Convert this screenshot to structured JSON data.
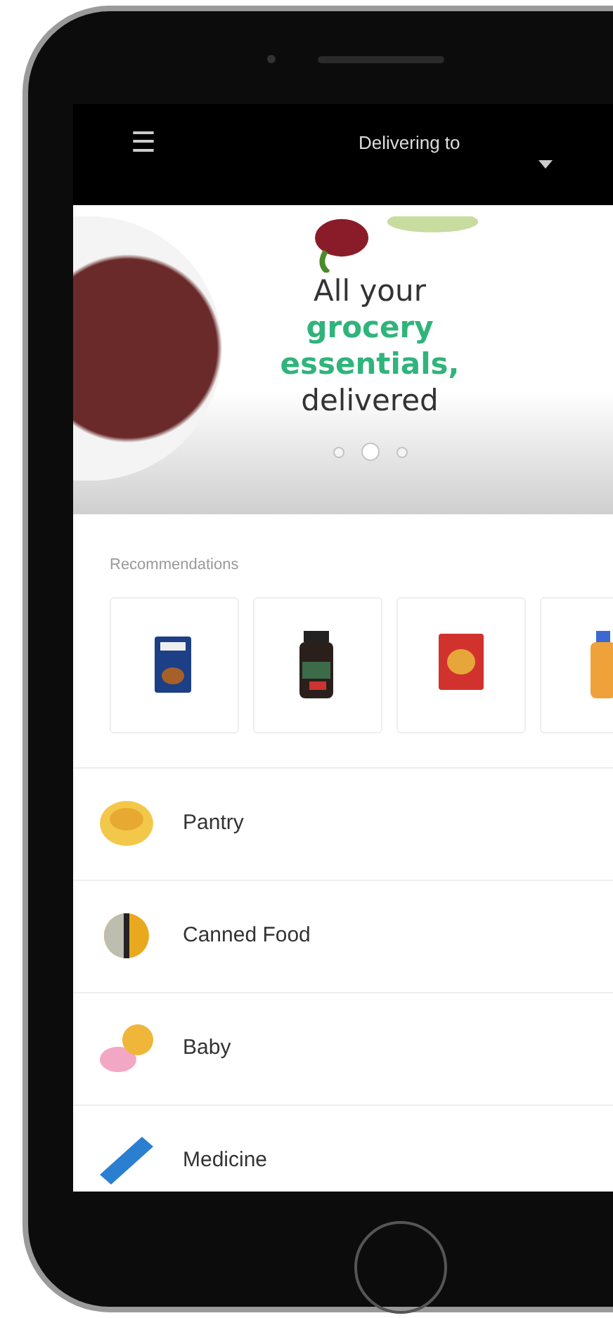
{
  "header": {
    "menu_icon": "☰",
    "title": "Delivering to"
  },
  "banner": {
    "lines": [
      {
        "text": "All your",
        "highlight": false
      },
      {
        "text": "grocery",
        "highlight": true
      },
      {
        "text": "essentials,",
        "highlight": true
      },
      {
        "text": "delivered",
        "highlight": false
      }
    ],
    "dots": [
      {
        "selected": false
      },
      {
        "selected": true
      },
      {
        "selected": false
      }
    ]
  },
  "recommendations": {
    "title": "Recommendations",
    "products": [
      {
        "kind": "box"
      },
      {
        "kind": "jar"
      },
      {
        "kind": "bag"
      },
      {
        "kind": "bottle"
      }
    ]
  },
  "categories": [
    {
      "kind": "pantry",
      "label": "Pantry"
    },
    {
      "kind": "canned",
      "label": "Canned Food"
    },
    {
      "kind": "baby",
      "label": "Baby"
    },
    {
      "kind": "medicine",
      "label": "Medicine"
    }
  ]
}
